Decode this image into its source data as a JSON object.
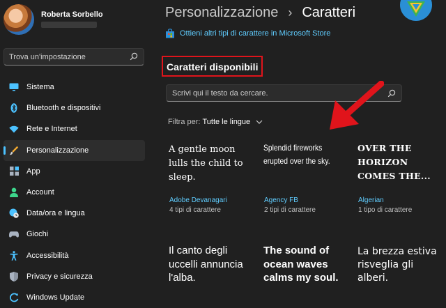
{
  "user": {
    "name": "Roberta Sorbello"
  },
  "sidebar": {
    "search_placeholder": "Trova un'impostazione",
    "items": [
      {
        "label": "Sistema",
        "icon": "monitor-icon",
        "color": "#4cc2ff",
        "active": false
      },
      {
        "label": "Bluetooth e dispositivi",
        "icon": "bluetooth-icon",
        "color": "#4cc2ff",
        "active": false
      },
      {
        "label": "Rete e Internet",
        "icon": "wifi-icon",
        "color": "#4cc2ff",
        "active": false
      },
      {
        "label": "Personalizzazione",
        "icon": "brush-icon",
        "color": "#f0a830",
        "active": true
      },
      {
        "label": "App",
        "icon": "apps-icon",
        "color": "#a9b3c1",
        "active": false
      },
      {
        "label": "Account",
        "icon": "person-icon",
        "color": "#3dd68c",
        "active": false
      },
      {
        "label": "Data/ora e lingua",
        "icon": "globe-clock-icon",
        "color": "#4cc2ff",
        "active": false
      },
      {
        "label": "Giochi",
        "icon": "gamepad-icon",
        "color": "#a9b3c1",
        "active": false
      },
      {
        "label": "Accessibilità",
        "icon": "accessibility-icon",
        "color": "#4cc2ff",
        "active": false
      },
      {
        "label": "Privacy e sicurezza",
        "icon": "shield-icon",
        "color": "#a9b3c1",
        "active": false
      },
      {
        "label": "Windows Update",
        "icon": "update-icon",
        "color": "#4cc2ff",
        "active": false
      }
    ]
  },
  "header": {
    "parent": "Personalizzazione",
    "separator": "›",
    "current": "Caratteri"
  },
  "store_link": "Ottieni altri tipi di carattere in Microsoft Store",
  "section_title": "Caratteri disponibili",
  "font_search_placeholder": "Scrivi qui il testo da cercare.",
  "filter": {
    "label": "Filtra per:",
    "value": "Tutte le lingue"
  },
  "fonts": [
    {
      "sample": "A gentle moon lulls the child to sleep.",
      "name": "Adobe Devanagari",
      "count": "4 tipi di carattere"
    },
    {
      "sample": "Splendid fireworks erupted over the sky.",
      "name": "Agency FB",
      "count": "2 tipi di carattere"
    },
    {
      "sample": "OVER THE HORIZON COMES THE...",
      "name": "Algerian",
      "count": "1 tipo di carattere"
    },
    {
      "sample": "Il canto degli uccelli annuncia l'alba."
    },
    {
      "sample": "The sound of ocean waves calms my soul."
    },
    {
      "sample": "La brezza estiva risveglia gli alberi."
    }
  ],
  "colors": {
    "accent": "#60cdff",
    "highlight_box": "#e0141b",
    "arrow": "#e0141b",
    "background": "#202020"
  }
}
